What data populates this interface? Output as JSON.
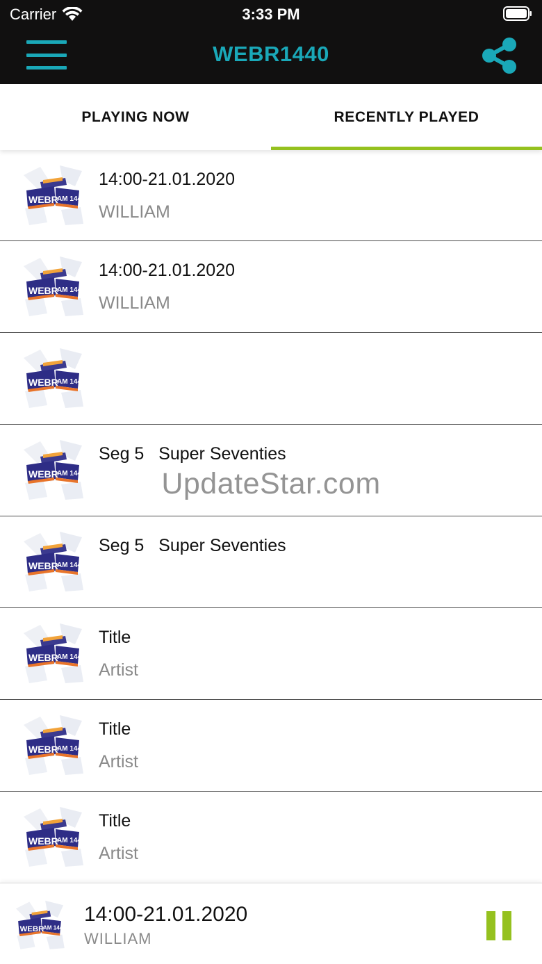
{
  "status_bar": {
    "carrier": "Carrier",
    "time": "3:33 PM"
  },
  "nav": {
    "title": "WEBR1440",
    "accent_color": "#1aa8b8",
    "menu_icon": "hamburger-menu-icon",
    "share_icon": "share-icon"
  },
  "tabs": [
    {
      "label": "PLAYING NOW",
      "active": false
    },
    {
      "label": "RECENTLY PLAYED",
      "active": true
    }
  ],
  "tab_indicator_color": "#95c11f",
  "logo": {
    "left": "WEBR",
    "right": "AM 1440"
  },
  "recently_played": [
    {
      "title": "14:00-21.01.2020",
      "artist": "WILLIAM"
    },
    {
      "title": "14:00-21.01.2020",
      "artist": "WILLIAM"
    },
    {
      "title": "",
      "artist": ""
    },
    {
      "title": "Seg 5   Super Seventies",
      "artist": ""
    },
    {
      "title": "Seg 5   Super Seventies",
      "artist": ""
    },
    {
      "title": "Title",
      "artist": "Artist"
    },
    {
      "title": "Title",
      "artist": "Artist"
    },
    {
      "title": "Title",
      "artist": "Artist"
    }
  ],
  "watermark": "UpdateStar.com",
  "player": {
    "title": "14:00-21.01.2020",
    "artist": "WILLIAM",
    "control_icon": "pause-icon",
    "control_color": "#95c11f"
  }
}
